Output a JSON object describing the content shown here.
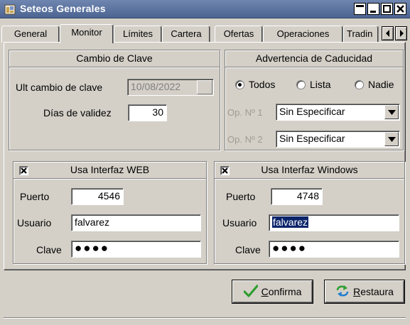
{
  "window": {
    "title": "Seteos Generales",
    "controls": [
      "restore-icon",
      "minimize-icon",
      "maximize-icon",
      "close-icon"
    ]
  },
  "tabs": [
    {
      "label": "General",
      "active": false
    },
    {
      "label": "Monitor",
      "active": true
    },
    {
      "label": "Límites",
      "active": false
    },
    {
      "label": "Cartera",
      "active": false
    },
    {
      "label": "Ofertas",
      "active": false
    },
    {
      "label": "Operaciones",
      "active": false
    },
    {
      "label": "Tradin",
      "active": false
    }
  ],
  "cambio_clave": {
    "title": "Cambio de Clave",
    "ult_cambio_label": "Ult cambio de clave",
    "ult_cambio_value": "10/08/2022",
    "dias_label": "Días de validez",
    "dias_value": "30"
  },
  "advertencia": {
    "title": "Advertencia de Caducidad",
    "options": [
      {
        "label": "Todos",
        "selected": true
      },
      {
        "label": "Lista",
        "selected": false
      },
      {
        "label": "Nadie",
        "selected": false
      }
    ],
    "op1_label": "Op. Nº 1",
    "op1_value": "Sin Especificar",
    "op2_label": "Op. Nº 2",
    "op2_value": "Sin Especificar"
  },
  "web": {
    "title": "Usa Interfaz WEB",
    "checked": true,
    "puerto_label": "Puerto",
    "puerto_value": "4546",
    "usuario_label": "Usuario",
    "usuario_value": "falvarez",
    "clave_label": "Clave",
    "clave_value": "●●●●"
  },
  "windows": {
    "title": "Usa Interfaz Windows",
    "checked": true,
    "puerto_label": "Puerto",
    "puerto_value": "4748",
    "usuario_label": "Usuario",
    "usuario_value": "falvarez",
    "clave_label": "Clave",
    "clave_value": "●●●●"
  },
  "buttons": {
    "confirma_mnemonic": "C",
    "confirma_rest": "onfirma",
    "restaura_mnemonic": "R",
    "restaura_rest": "estaura"
  },
  "colors": {
    "titlebar": "#5a72a0",
    "face": "#d4d0c8",
    "selection": "#0a246a",
    "check_green": "#2e9e2e"
  }
}
